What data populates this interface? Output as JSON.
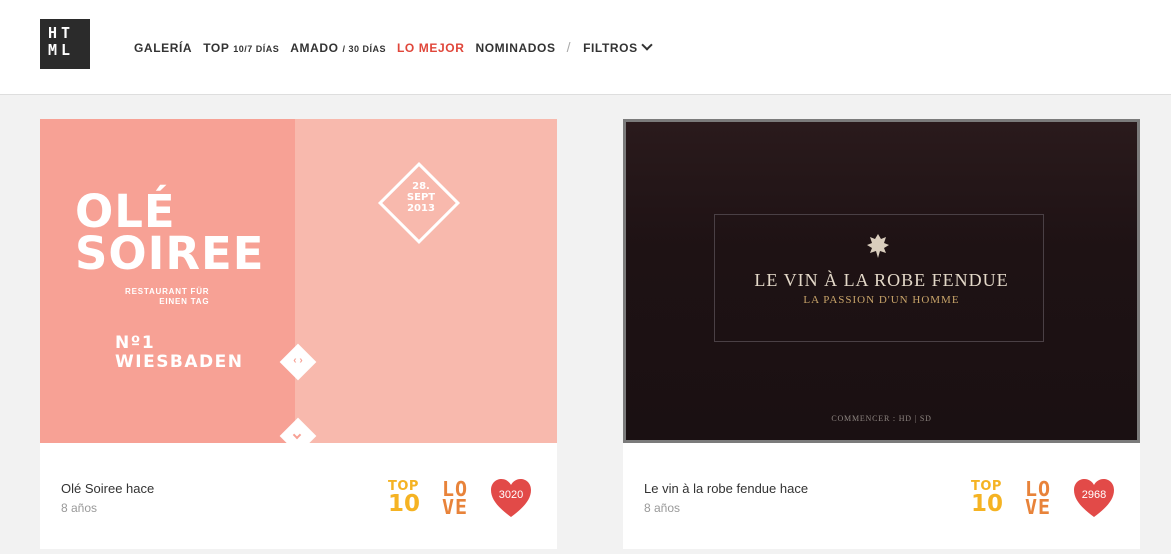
{
  "logo": {
    "lines": [
      "HT",
      "ML"
    ]
  },
  "nav": {
    "galeria": "GALERÍA",
    "top_main": "TOP",
    "top_small": "10/7 DÍAS",
    "amado_main": "AMADO",
    "amado_small": "/ 30 DÍAS",
    "mejor": "LO MEJOR",
    "nominados": "NOMINADOS",
    "separator": "/",
    "filtros": "FILTROS"
  },
  "colors": {
    "accent": "#e0463a",
    "top_badge": "#f5b323",
    "love_badge": "#e8833a",
    "heart": "#e24a48"
  },
  "cards": [
    {
      "title": "Olé Soiree hace",
      "age": "8 años",
      "badge_top": "TOP",
      "badge_top_num": "10",
      "badge_love_1": "LO",
      "badge_love_2": "VE",
      "likes": "3020",
      "art": {
        "line1": "OLÉ",
        "line2": "SOIREE",
        "tag1": "RESTAURANT FÜR",
        "tag2": "EINEN TAG",
        "num1": "Nº1",
        "num2": "WIESBADEN",
        "date1": "28.",
        "date2": "SEPT",
        "date3": "2013",
        "arrows": "‹ ›"
      }
    },
    {
      "title": "Le vin à la robe fendue hace",
      "age": "8 años",
      "badge_top": "TOP",
      "badge_top_num": "10",
      "badge_love_1": "LO",
      "badge_love_2": "VE",
      "likes": "2968",
      "art": {
        "title": "LE VIN À LA ROBE FENDUE",
        "subtitle": "LA PASSION D'UN HOMME",
        "footer": "COMMENCER : HD | SD"
      }
    }
  ]
}
